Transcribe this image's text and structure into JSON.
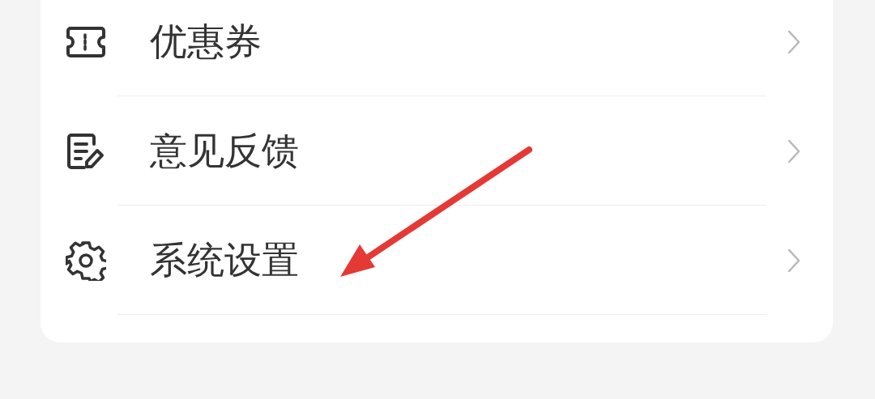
{
  "menu": [
    {
      "kind": "coupon",
      "label": "优惠券"
    },
    {
      "kind": "feedback",
      "label": "意见反馈"
    },
    {
      "kind": "settings",
      "label": "系统设置"
    }
  ]
}
